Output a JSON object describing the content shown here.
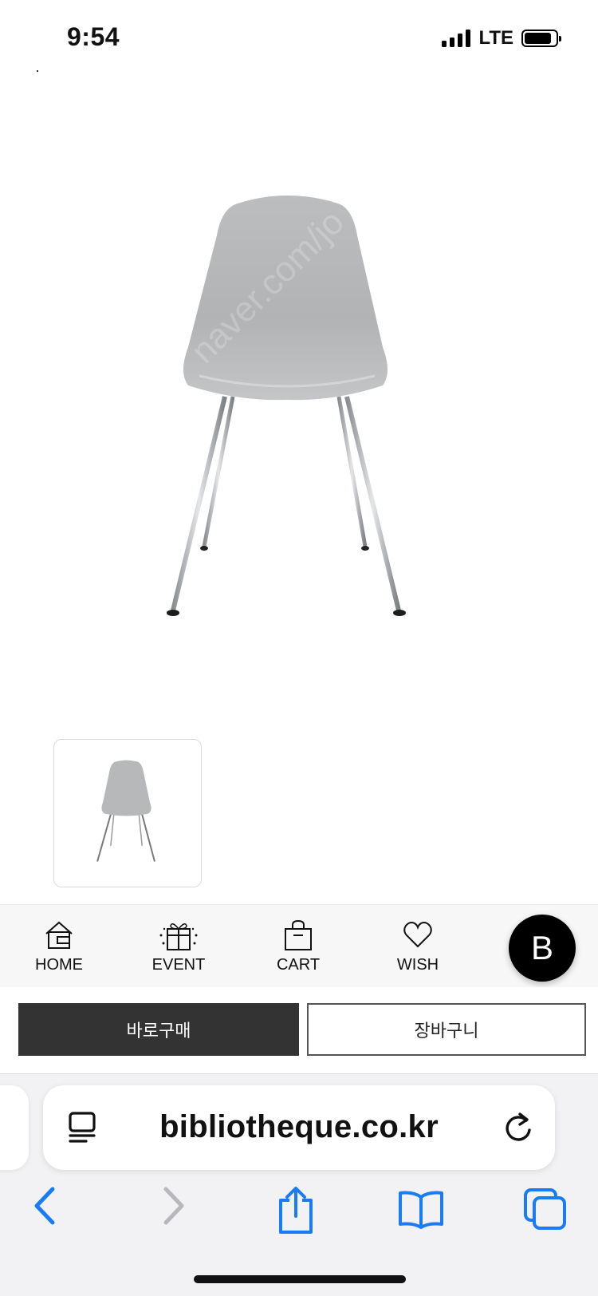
{
  "status_bar": {
    "time": "9:54",
    "network": "LTE"
  },
  "product": {
    "image_icon": "chair-image",
    "watermark": "naver.com/jo"
  },
  "shop_nav": {
    "items": [
      {
        "label": "HOME",
        "icon": "home-icon"
      },
      {
        "label": "EVENT",
        "icon": "gift-icon"
      },
      {
        "label": "CART",
        "icon": "bag-icon"
      },
      {
        "label": "WISH",
        "icon": "heart-icon"
      }
    ],
    "floating_button": "B"
  },
  "actions": {
    "buy_now": "바로구매",
    "add_to_cart": "장바구니"
  },
  "browser": {
    "url": "bibliotheque.co.kr",
    "accent_color": "#1a7cf5"
  }
}
